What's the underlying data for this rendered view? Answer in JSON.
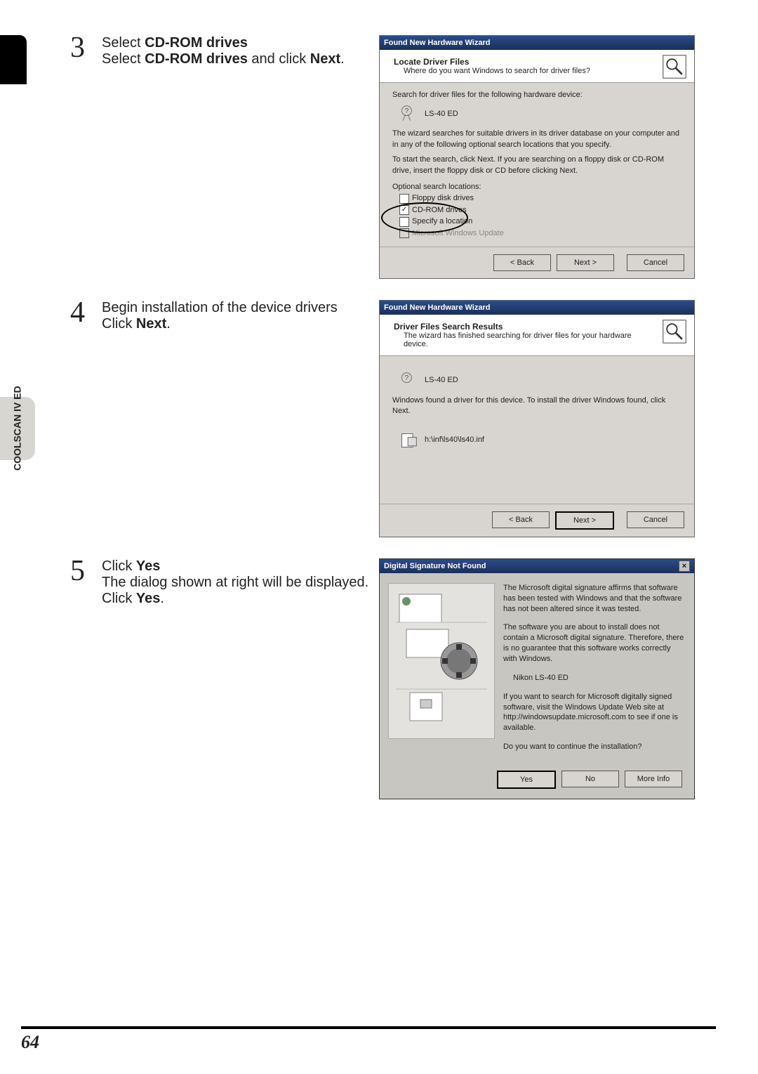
{
  "sidebar": {
    "label": "COOLSCAN IV ED"
  },
  "steps": [
    {
      "num": "3",
      "heading_prefix": "Select ",
      "heading_bold": "CD-ROM drives",
      "body_html": "Select <b>CD-ROM drives</b> and click <b>Next</b>."
    },
    {
      "num": "4",
      "heading_plain": "Begin installation of the device drivers",
      "body_html": "Click <b>Next</b>."
    },
    {
      "num": "5",
      "heading_prefix": "Click ",
      "heading_bold": "Yes",
      "body_html": "The dialog shown at right will be displayed. Click <b>Yes</b>."
    }
  ],
  "dialog1": {
    "title": "Found New Hardware Wizard",
    "head_bold": "Locate Driver Files",
    "head_sub": "Where do you want Windows to search for driver files?",
    "line1": "Search for driver files for the following hardware device:",
    "device": "LS-40 ED",
    "para1": "The wizard searches for suitable drivers in its driver database on your computer and in any of the following optional search locations that you specify.",
    "para2": "To start the search, click Next. If you are searching on a floppy disk or CD-ROM drive, insert the floppy disk or CD before clicking Next.",
    "opt_label": "Optional search locations:",
    "options": [
      {
        "label": "Floppy disk drives",
        "checked": false,
        "disabled": false
      },
      {
        "label": "CD-ROM drives",
        "checked": true,
        "disabled": false
      },
      {
        "label": "Specify a location",
        "checked": false,
        "disabled": false
      },
      {
        "label": "Microsoft Windows Update",
        "checked": false,
        "disabled": true
      }
    ],
    "buttons": {
      "back": "< Back",
      "next": "Next >",
      "cancel": "Cancel"
    }
  },
  "dialog2": {
    "title": "Found New Hardware Wizard",
    "head_bold": "Driver Files Search Results",
    "head_sub": "The wizard has finished searching for driver files for your hardware device.",
    "device": "LS-40 ED",
    "para1": "Windows found a driver for this device. To install the driver Windows found, click Next.",
    "inf_path": "h:\\inf\\ls40\\ls40.inf",
    "buttons": {
      "back": "< Back",
      "next": "Next >",
      "cancel": "Cancel"
    }
  },
  "dialog3": {
    "title": "Digital Signature Not Found",
    "p1": "The Microsoft digital signature affirms that software has been tested with Windows and that the software has not been altered since it was tested.",
    "p2": "The software you are about to install does not contain a Microsoft digital signature. Therefore, there is no guarantee that this software works correctly with Windows.",
    "device": "Nikon LS-40 ED",
    "p3": "If you want to search for Microsoft digitally signed software, visit the Windows Update Web site at http://windowsupdate.microsoft.com to see if one is available.",
    "p4": "Do you want to continue the installation?",
    "buttons": {
      "yes": "Yes",
      "no": "No",
      "more": "More Info"
    }
  },
  "page_number": "64"
}
